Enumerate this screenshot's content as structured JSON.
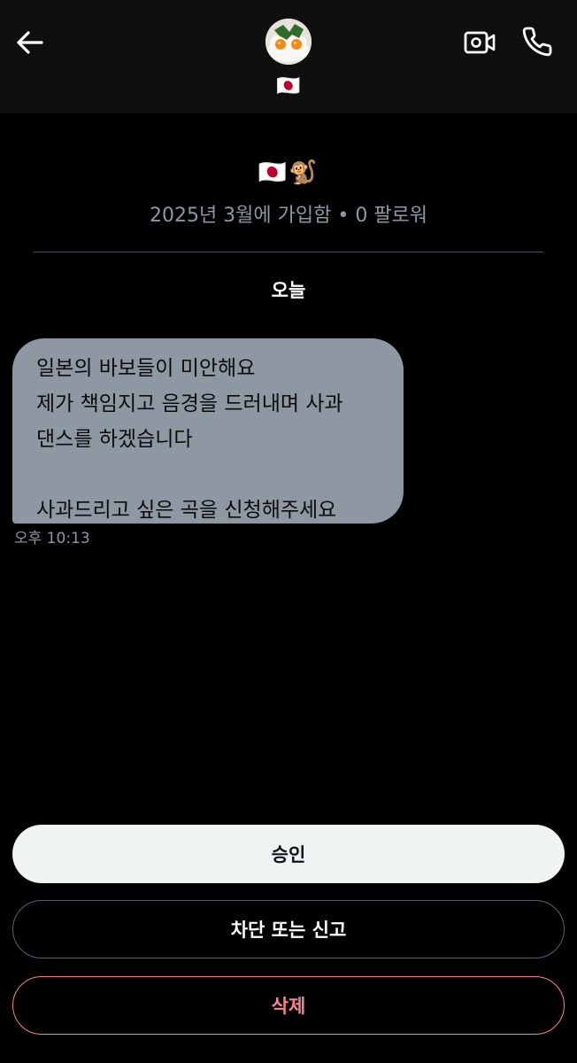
{
  "header": {
    "back_icon": "arrow-left-icon",
    "avatar_icon": "fried-egg-avatar",
    "flag": "🇯🇵",
    "video_icon": "video-call-icon",
    "phone_icon": "phone-icon"
  },
  "profile": {
    "bio": "🇯🇵🐒",
    "joined_text": "2025년 3월에 가입함 • 0 팔로워"
  },
  "conversation": {
    "date_separator": "오늘",
    "messages": [
      {
        "text": "일본의 바보들이 미안해요\n제가 책임지고 음경을 드러내며 사과\n댄스를 하겠습니다\n\n사과드리고 싶은 곡을 신청해주세요",
        "time": "오후 10:13"
      }
    ]
  },
  "actions": {
    "approve_label": "승인",
    "block_report_label": "차단 또는 신고",
    "delete_label": "삭제"
  },
  "colors": {
    "background": "#000000",
    "header_background": "#0f0f10",
    "bubble": "#8e98a3",
    "muted_text": "#8b98a5",
    "approve_button": "#eff3f4",
    "delete_accent": "#f4868e"
  }
}
